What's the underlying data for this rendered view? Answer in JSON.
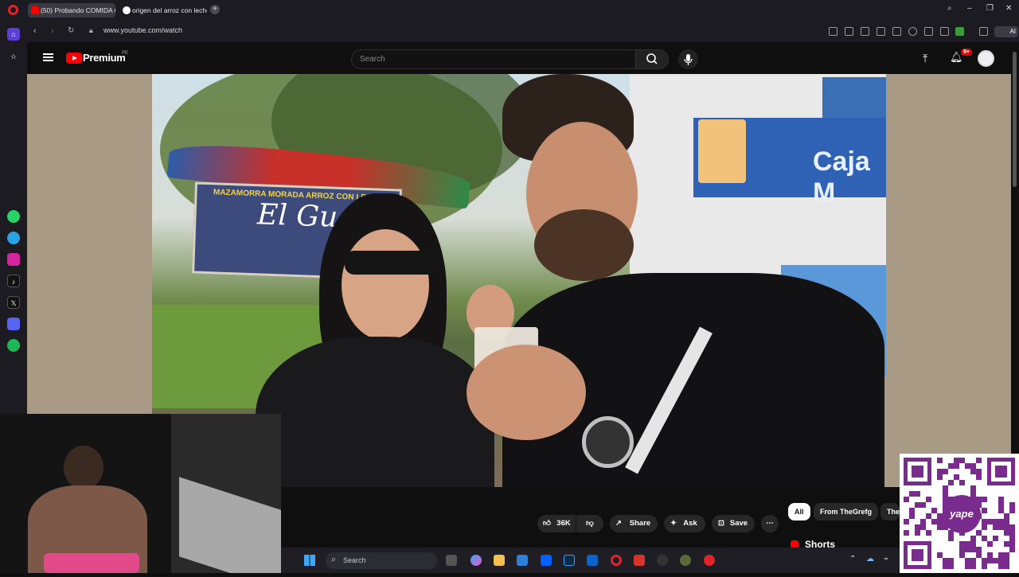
{
  "browser": {
    "tabs": [
      {
        "title": "(50) Probando COMIDA C"
      },
      {
        "title": "origen del arroz con leche"
      }
    ],
    "new_tab": "+",
    "url": "www.youtube.com/watch",
    "ai_label": "AI"
  },
  "youtube": {
    "brand": "Premium",
    "country": "PE",
    "search_placeholder": "Search",
    "notification_count": "9+"
  },
  "actions": {
    "likes": "36K",
    "share": "Share",
    "ask": "Ask",
    "save": "Save"
  },
  "chips": [
    {
      "label": "All"
    },
    {
      "label": "From TheGrefg"
    },
    {
      "label": "The"
    }
  ],
  "shorts_label": "Shorts",
  "video_sign": {
    "board_line": "MAZAMORRA MORADA ARROZ CON LECHE",
    "board_name": "El Gu",
    "bank": "Caja M"
  },
  "qr_brand": "yape",
  "taskbar": {
    "search_placeholder": "Search"
  },
  "colors": {
    "youtube_red": "#FF0000",
    "notification_badge": "#E00000",
    "yape_purple": "#7A2C8E"
  }
}
